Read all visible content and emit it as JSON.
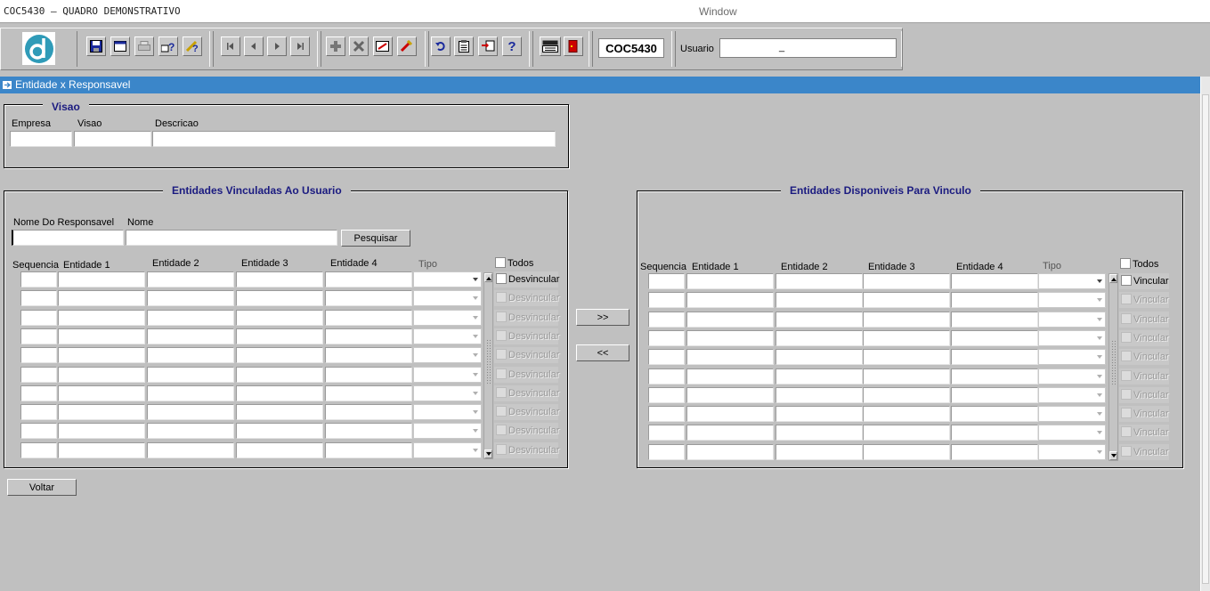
{
  "app": {
    "title": "COC5430 – QUADRO DEMONSTRATIVO",
    "window_menu": "Window"
  },
  "toolbar": {
    "form_code": "COC5430",
    "usuario_label": "Usuario",
    "usuario_value": "_",
    "buttons": [
      "save-icon",
      "window-icon",
      "print-icon",
      "query-help-icon",
      "execute-query-icon",
      "first-record-icon",
      "previous-record-icon",
      "next-record-icon",
      "last-record-icon",
      "insert-record-icon",
      "delete-record-icon",
      "clear-record-icon",
      "edit-icon",
      "undo-icon",
      "clipboard-icon",
      "exchange-icon",
      "help-icon",
      "menu-icon",
      "exit-icon"
    ]
  },
  "window": {
    "title": "Entidade x Responsavel"
  },
  "visao": {
    "title": "Visao",
    "empresa_label": "Empresa",
    "visao_label": "Visao",
    "descricao_label": "Descricao"
  },
  "vinculadas": {
    "title": "Entidades Vinculadas Ao Usuario",
    "nome_responsavel_label": "Nome Do Responsavel",
    "nome_label": "Nome",
    "pesquisar_label": "Pesquisar",
    "columns": [
      "Sequencia",
      "Entidade 1",
      "Entidade 2",
      "Entidade 3",
      "Entidade 4",
      "Tipo"
    ],
    "todos_label": "Todos",
    "row_action": "Desvincular",
    "row_count": 10
  },
  "disponiveis": {
    "title": "Entidades Disponiveis Para Vinculo",
    "columns": [
      "Sequencia",
      "Entidade 1",
      "Entidade 2",
      "Entidade 3",
      "Entidade 4",
      "Tipo"
    ],
    "todos_label": "Todos",
    "row_action": "Vincular",
    "row_count": 10
  },
  "transfer": {
    "add_label": ">>",
    "remove_label": "<<"
  },
  "voltar_label": "Voltar",
  "colors": {
    "window_bar": "#3b86c9",
    "frame_title": "#1b1b80",
    "background": "#c0c0c0"
  }
}
